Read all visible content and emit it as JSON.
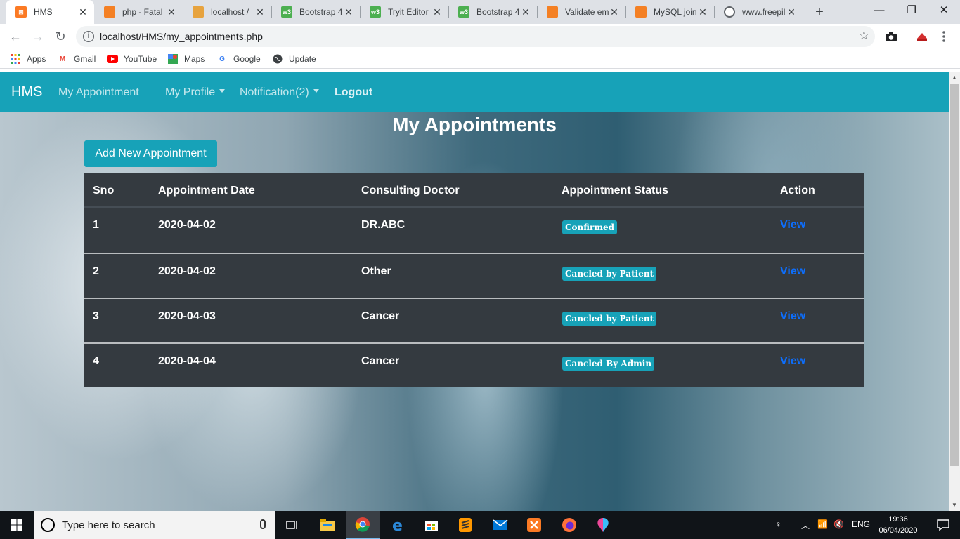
{
  "browser": {
    "tabs": [
      {
        "label": "HMS",
        "icon": "xampp-icon",
        "active": true
      },
      {
        "label": "php - Fatal",
        "icon": "stackoverflow-icon"
      },
      {
        "label": "localhost /",
        "icon": "phpmyadmin-icon"
      },
      {
        "label": "Bootstrap 4",
        "icon": "w3schools-icon"
      },
      {
        "label": "Tryit Editor",
        "icon": "w3schools-icon"
      },
      {
        "label": "Bootstrap 4",
        "icon": "w3schools-icon"
      },
      {
        "label": "Validate em",
        "icon": "stackoverflow-icon"
      },
      {
        "label": "MySQL join",
        "icon": "stackoverflow-icon"
      },
      {
        "label": "www.freepil",
        "icon": "globe-icon"
      }
    ],
    "url": "localhost/HMS/my_appointments.php",
    "bookmarks": [
      "Apps",
      "Gmail",
      "YouTube",
      "Maps",
      "Google",
      "Update"
    ]
  },
  "app": {
    "brand": "HMS",
    "nav": {
      "my_appointment": "My Appointment",
      "my_profile": "My Profile",
      "notification": "Notification(2)",
      "logout": "Logout"
    },
    "page_title": "My Appointments",
    "add_button": "Add New Appointment",
    "table": {
      "headers": [
        "Sno",
        "Appointment Date",
        "Consulting Doctor",
        "Appointment Status",
        "Action"
      ],
      "rows": [
        {
          "sno": "1",
          "date": "2020-04-02",
          "doctor": "DR.ABC",
          "status": "Confirmed",
          "action": "View"
        },
        {
          "sno": "2",
          "date": "2020-04-02",
          "doctor": "Other",
          "status": "Cancled by Patient",
          "action": "View"
        },
        {
          "sno": "3",
          "date": "2020-04-03",
          "doctor": "Cancer",
          "status": "Cancled by Patient",
          "action": "View"
        },
        {
          "sno": "4",
          "date": "2020-04-04",
          "doctor": "Cancer",
          "status": "Cancled By Admin",
          "action": "View"
        }
      ]
    },
    "colors": {
      "primary": "#17a2b8",
      "table_dark": "#343a40",
      "link": "#0d6efd"
    }
  },
  "taskbar": {
    "search_placeholder": "Type here to search",
    "language": "ENG",
    "time": "19:36",
    "date": "06/04/2020"
  }
}
